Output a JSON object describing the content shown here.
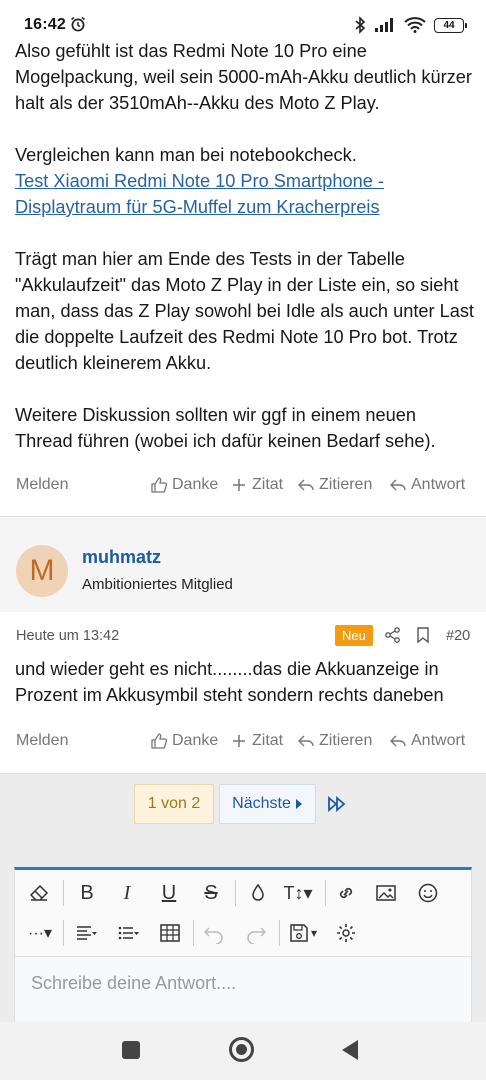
{
  "status_bar": {
    "time": "16:42",
    "battery": "44",
    "icons": [
      "alarm-icon",
      "bluetooth-icon",
      "signal-icon",
      "wifi-icon",
      "battery-icon"
    ]
  },
  "post1": {
    "paragraphs": [
      "Also gefühlt ist das Redmi Note 10 Pro eine Mogelpackung, weil sein 5000-mAh-Akku deutlich kürzer halt als der 3510mAh--Akku des Moto Z Play.",
      "Vergleichen kann man bei notebookcheck.",
      "Trägt man hier am Ende des Tests in der Tabelle \"Akkulaufzeit\" das Moto Z Play in der Liste ein, so sieht man, dass das Z Play sowohl bei Idle als auch unter Last die doppelte Laufzeit des Redmi Note 10 Pro bot. Trotz deutlich kleinerem Akku.",
      "Weitere Diskussion sollten wir ggf in einem neuen Thread führen (wobei ich dafür keinen Bedarf sehe)."
    ],
    "link": "Test Xiaomi Redmi Note 10 Pro Smartphone - Displaytraum für 5G-Muffel zum Kracherpreis"
  },
  "actions": {
    "melden": "Melden",
    "danke": "Danke",
    "zitat": "Zitat",
    "zitieren": "Zitieren",
    "antwort": "Antwort"
  },
  "post2": {
    "avatar_letter": "M",
    "username": "muhmatz",
    "role": "Ambitioniertes Mitglied",
    "date": "Heute um 13:42",
    "badge": "Neu",
    "number": "#20",
    "text": "und wieder geht es nicht........das die Akkuanzeige in Prozent im Akkusymbil steht sondern rechts daneben"
  },
  "pagination": {
    "current": "1 von 2",
    "next": "Nächste"
  },
  "editor": {
    "placeholder": "Schreibe deine Antwort....",
    "accent_color": "#2b7bc2"
  },
  "colors": {
    "link": "#2563a6",
    "username": "#1c5aa6",
    "badge": "#f39c12"
  }
}
